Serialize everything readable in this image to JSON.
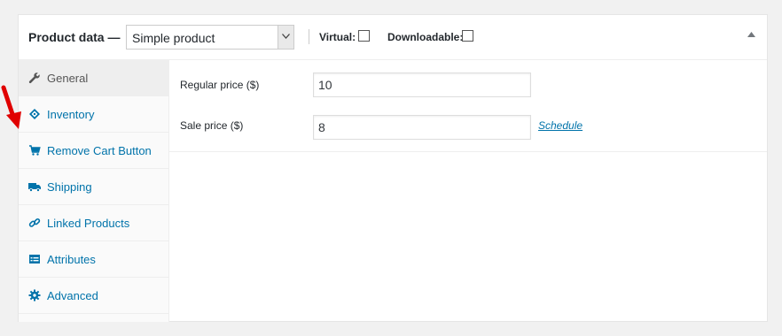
{
  "header": {
    "title": "Product data —",
    "product_type": "Simple product",
    "virtual_label": "Virtual:",
    "downloadable_label": "Downloadable:"
  },
  "tabs": [
    {
      "label": "General",
      "icon": "wrench-icon",
      "active": true
    },
    {
      "label": "Inventory",
      "icon": "tag-icon"
    },
    {
      "label": "Remove Cart Button",
      "icon": "cart-icon"
    },
    {
      "label": "Shipping",
      "icon": "truck-icon"
    },
    {
      "label": "Linked Products",
      "icon": "link-icon"
    },
    {
      "label": "Attributes",
      "icon": "list-icon"
    },
    {
      "label": "Advanced",
      "icon": "gear-icon"
    }
  ],
  "general": {
    "regular_price_label": "Regular price ($)",
    "regular_price_value": "10",
    "sale_price_label": "Sale price ($)",
    "sale_price_value": "8",
    "schedule_link": "Schedule"
  },
  "colors": {
    "link": "#0073aa",
    "annotation_arrow": "#e00000"
  }
}
